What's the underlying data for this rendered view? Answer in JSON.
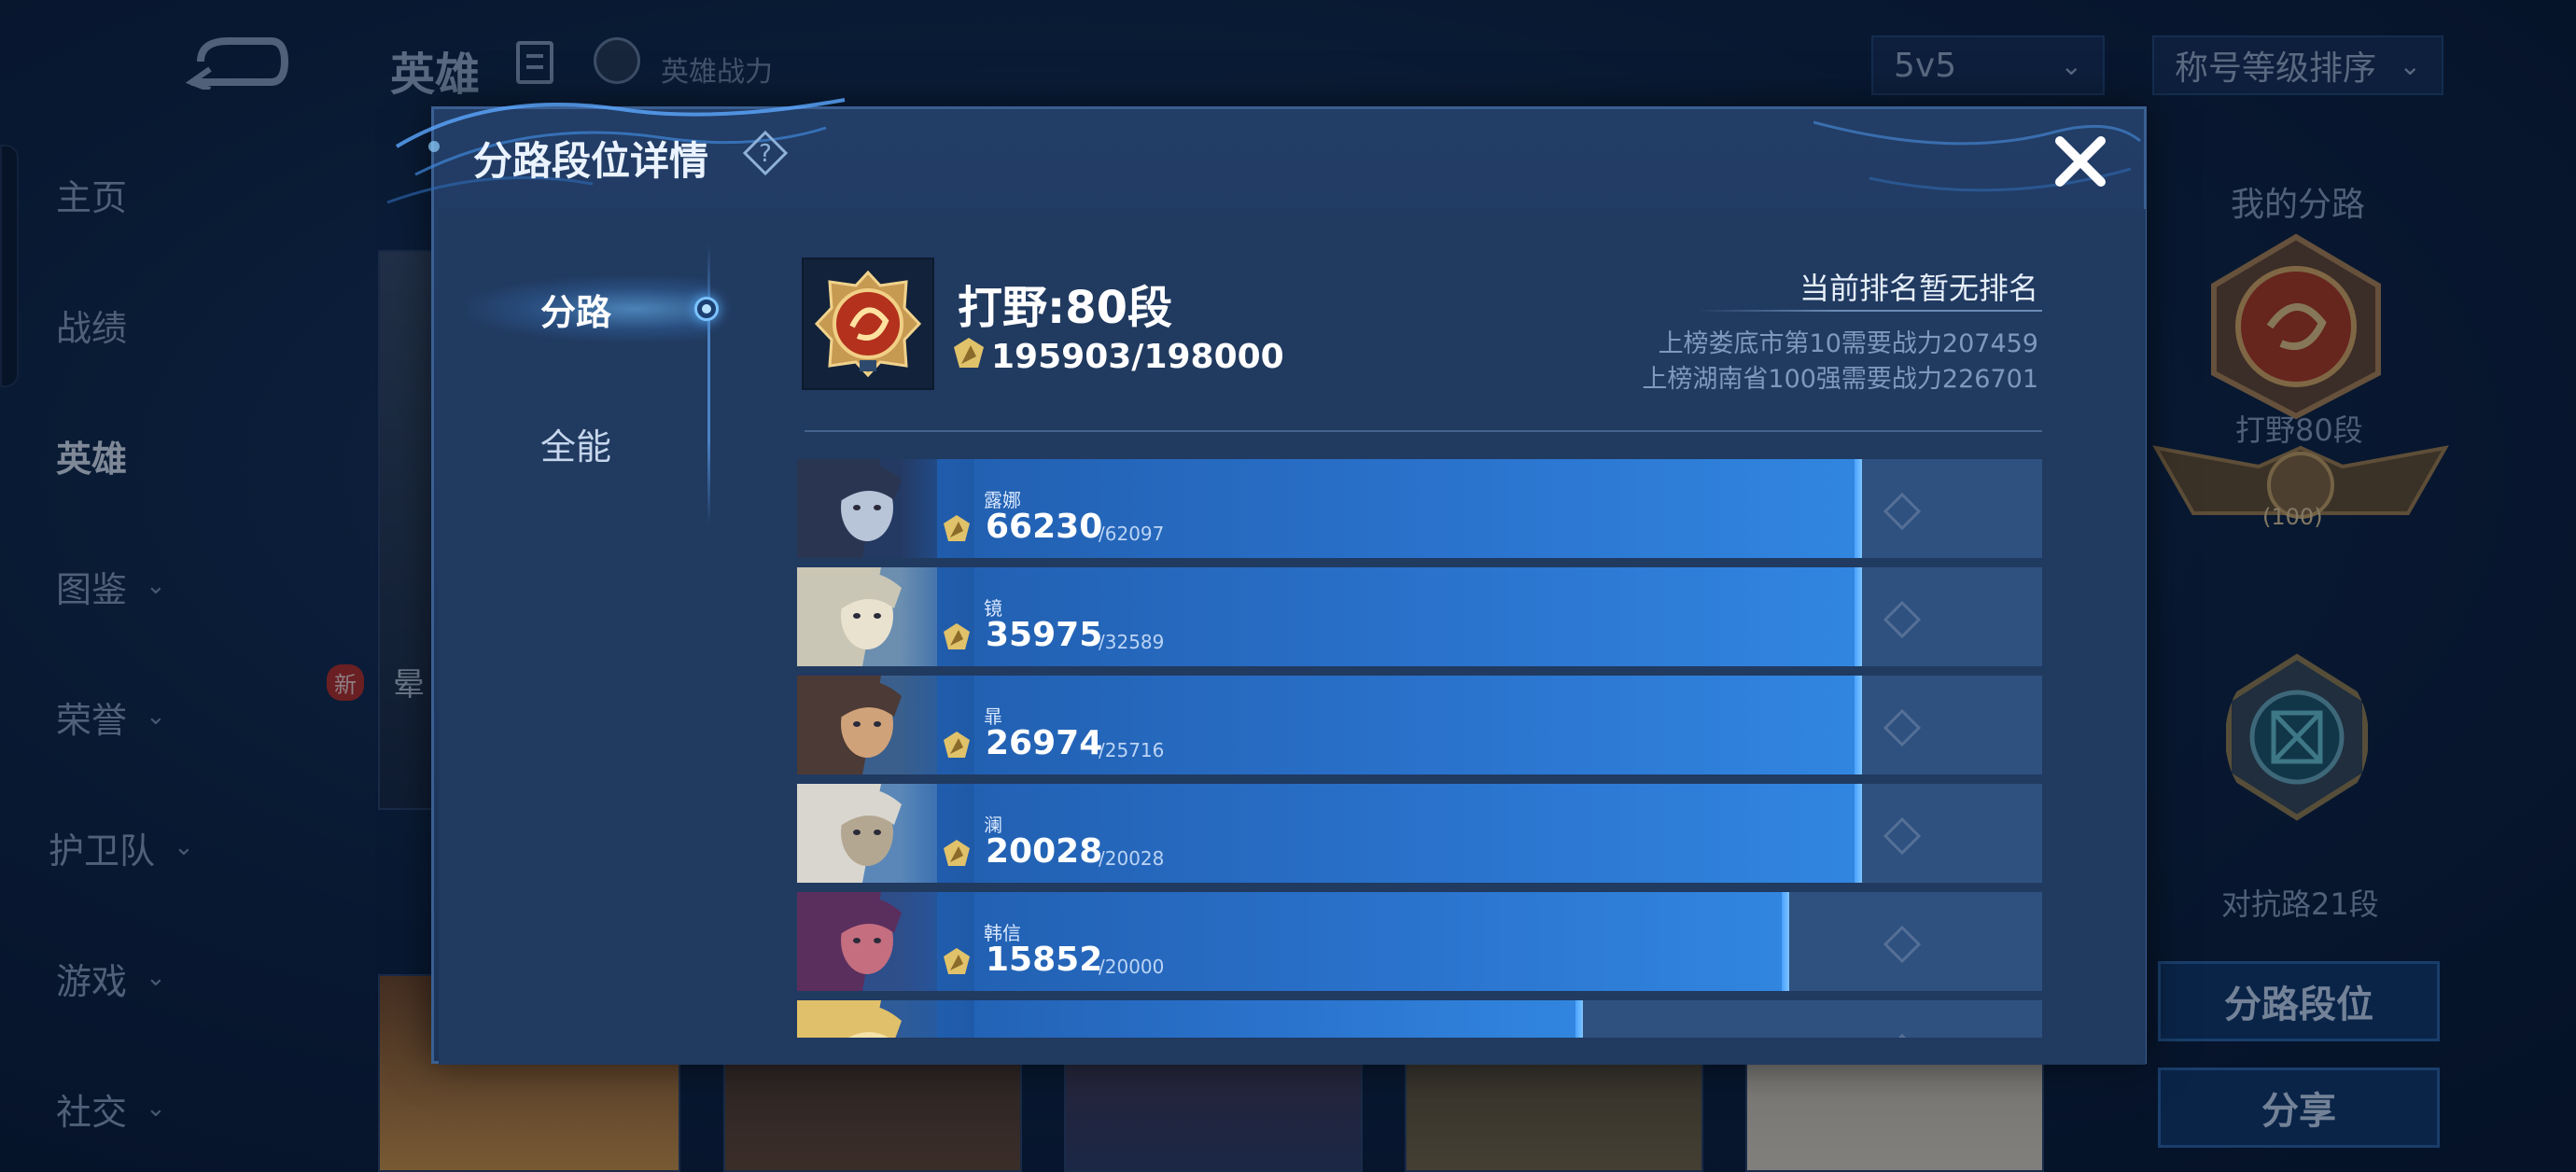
{
  "background": {
    "header": {
      "title": "英雄",
      "power_label": "英雄战力",
      "mode_select": "5v5",
      "sort_select": "称号等级排序"
    },
    "nav": [
      {
        "label": "主页",
        "active": false,
        "chevron": false
      },
      {
        "label": "战绩",
        "active": false,
        "chevron": false
      },
      {
        "label": "英雄",
        "active": true,
        "chevron": false
      },
      {
        "label": "图鉴",
        "active": false,
        "chevron": true
      },
      {
        "label": "荣誉",
        "active": false,
        "chevron": true
      },
      {
        "label": "护卫队",
        "active": false,
        "chevron": true
      },
      {
        "label": "游戏",
        "active": false,
        "chevron": true
      },
      {
        "label": "社交",
        "active": false,
        "chevron": true
      }
    ],
    "new_badge": "新",
    "card_text": "晕",
    "right_panel": {
      "title": "我的分路",
      "lane_rank": "打野80段",
      "level_badge": "100",
      "other_rank": "对抗路21段",
      "lane_button": "分路段位",
      "share_button": "分享"
    }
  },
  "modal": {
    "title": "分路段位详情",
    "help_icon": "question-diamond-icon",
    "close_icon": "close-x-icon",
    "tabs": [
      {
        "label": "分路",
        "active": true
      },
      {
        "label": "全能",
        "active": false
      }
    ],
    "summary": {
      "lane_rank": "打野:80段",
      "power_current": "195903/198000",
      "rank_status": "当前排名暂无排名",
      "requirements": [
        "上榜娄底市第10需要战力207459",
        "上榜湖南省100强需要战力226701"
      ]
    },
    "heroes": [
      {
        "name": "露娜",
        "power": "66230",
        "max": "/62097",
        "fill": 0.855,
        "colors": [
          "#2a3552",
          "#b8c4d8",
          "#243a63"
        ]
      },
      {
        "name": "镜",
        "power": "35975",
        "max": "/32589",
        "fill": 0.855,
        "colors": [
          "#c9c6b5",
          "#e9e2cf",
          "#6c8fb0"
        ]
      },
      {
        "name": "暃",
        "power": "26974",
        "max": "/25716",
        "fill": 0.855,
        "colors": [
          "#4b3a35",
          "#cfa27a",
          "#3a5f8c"
        ]
      },
      {
        "name": "澜",
        "power": "20028",
        "max": "/20028",
        "fill": 0.855,
        "colors": [
          "#d8d6cf",
          "#b4a791",
          "#5a87b8"
        ]
      },
      {
        "name": "韩信",
        "power": "15852",
        "max": "/20000",
        "fill": 0.797,
        "colors": [
          "#5a2f5e",
          "#c56e7f",
          "#2e4e8a"
        ]
      },
      {
        "name": "",
        "power": "",
        "max": "",
        "fill": 0.631,
        "colors": [
          "#e0c06a",
          "#f4e2a8",
          "#2f5b98"
        ]
      }
    ],
    "accent_color": "#3186e0",
    "gold_color": "#e0c26a"
  }
}
